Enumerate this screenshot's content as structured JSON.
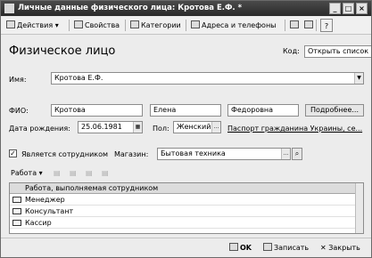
{
  "window": {
    "title": "Личные данные физического лица: Кротова Е.Ф. *",
    "min_glyph": "_",
    "max_glyph": "□",
    "close_glyph": "×"
  },
  "toolbar": {
    "actions_label": "Действия",
    "properties_label": "Свойства",
    "categories_label": "Категории",
    "addresses_label": "Адреса и телефоны",
    "help_label": "?"
  },
  "header": {
    "heading": "Физическое лицо",
    "code_label": "Код:",
    "code_value": "Открыть список д"
  },
  "form": {
    "name_label": "Имя:",
    "name_value": "Кротова Е.Ф.",
    "fio_label": "ФИО:",
    "last_name": "Кротова",
    "first_name": "Елена",
    "middle_name": "Федоровна",
    "more_button": "Подробнее...",
    "birth_label": "Дата рождения:",
    "birth_value": "25.06.1981",
    "gender_label": "Пол:",
    "gender_value": "Женский",
    "passport_link": "Паспорт гражданина Украины, се...",
    "employee_label": "Является сотрудником",
    "employee_checked": true,
    "store_label": "Магазин:",
    "store_value": "Бытовая техника"
  },
  "work": {
    "menu_label": "Работа",
    "column_header": "Работа, выполняемая сотрудником",
    "rows": [
      "Менеджер",
      "Консультант",
      "Кассир"
    ]
  },
  "footer": {
    "ok_label": "OK",
    "save_label": "Записать",
    "close_label": "Закрыть"
  }
}
